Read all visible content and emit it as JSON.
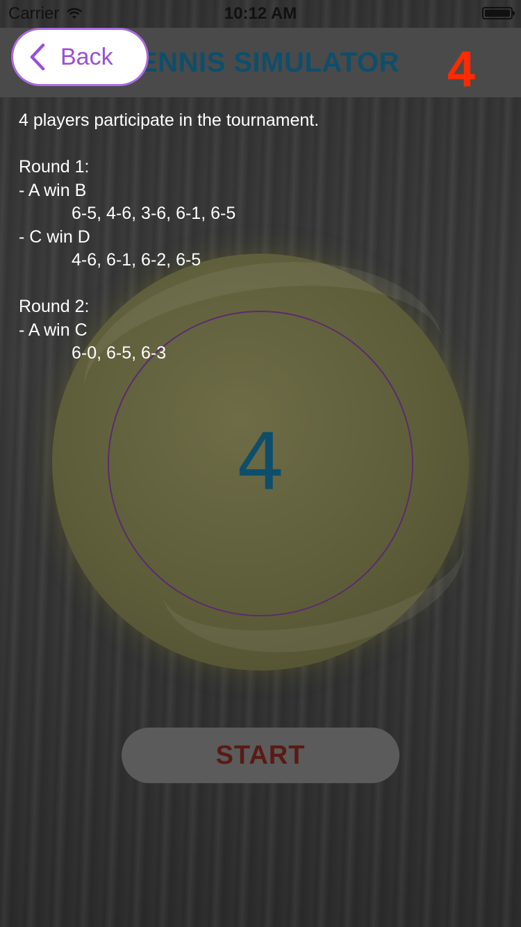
{
  "status_bar": {
    "carrier": "Carrier",
    "time": "10:12 AM"
  },
  "nav": {
    "title": "TENNIS SIMULATOR",
    "player_count": "4",
    "back_label": "Back"
  },
  "results": {
    "intro": "4 players participate in the tournament.",
    "rounds": [
      {
        "title": "Round 1:",
        "matches": [
          {
            "result": "- A win B",
            "score": "6-5, 4-6, 3-6, 6-1, 6-5"
          },
          {
            "result": "- C win D",
            "score": "4-6, 6-1, 6-2, 6-5"
          }
        ]
      },
      {
        "title": "Round 2:",
        "matches": [
          {
            "result": "- A win C",
            "score": "6-0, 6-5, 6-3"
          }
        ]
      }
    ]
  },
  "center": {
    "value": "4"
  },
  "start_button": {
    "label": "START"
  },
  "colors": {
    "title": "#0e4e6b",
    "count": "#ff2a00",
    "back_border": "#a96be0",
    "back_text": "#9b4fd6",
    "ring": "#5a2b6e",
    "start_text": "#5a1a14"
  }
}
